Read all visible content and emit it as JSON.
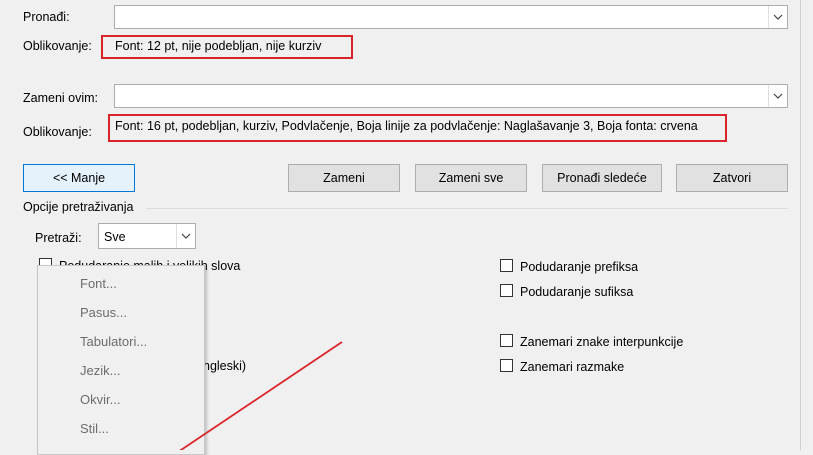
{
  "find": {
    "label": "Pronađi:",
    "value": "",
    "format_label": "Oblikovanje:",
    "format_text": "Font: 12 pt, nije podebljan, nije kurziv"
  },
  "replace": {
    "label": "Zameni ovim:",
    "value": "",
    "format_label": "Oblikovanje:",
    "format_text": "Font: 16 pt, podebljan, kurziv, Podvlačenje, Boja linije za podvlačenje: Naglašavanje 3, Boja fonta: crvena"
  },
  "buttons": {
    "less": "<< Manje",
    "replace": "Zameni",
    "replace_all": "Zameni sve",
    "find_next": "Pronađi sledeće",
    "close": "Zatvori"
  },
  "options": {
    "group_title": "Opcije pretraživanja",
    "search_label": "Pretraži:",
    "search_value": "Sve",
    "match_case": "Podudaranje malih i velikih slova",
    "partial_text": "ngleski)",
    "match_prefix": "Podudaranje prefiksa",
    "match_suffix": "Podudaranje sufiksa",
    "ignore_punctuation": "Zanemari znake interpunkcije",
    "ignore_spaces": "Zanemari razmake"
  },
  "format_menu": {
    "items": [
      "Font...",
      "Pasus...",
      "Tabulatori...",
      "Jezik...",
      "Okvir...",
      "Stil..."
    ]
  },
  "colors": {
    "highlight_red": "#d9252a",
    "focus_blue": "#0078d7"
  }
}
